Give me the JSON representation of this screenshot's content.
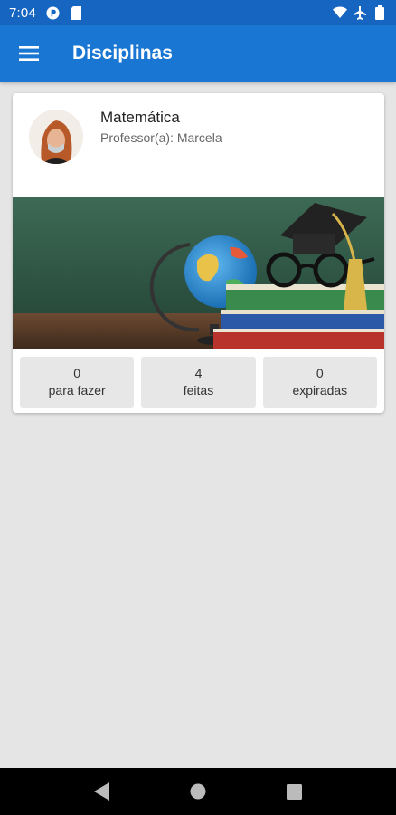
{
  "status_bar": {
    "time": "7:04",
    "icons": [
      "p-circle-icon",
      "sd-card-icon",
      "wifi-icon",
      "airplane-icon",
      "battery-icon"
    ]
  },
  "app_bar": {
    "title": "Disciplinas",
    "menu_icon": "menu-icon",
    "background": "#1976d2"
  },
  "course_card": {
    "subject": "Matemática",
    "teacher_label": "Professor(a):",
    "teacher_name": "Marcela",
    "stats": [
      {
        "count": "0",
        "label": "para fazer"
      },
      {
        "count": "4",
        "label": "feitas"
      },
      {
        "count": "0",
        "label": "expiradas"
      }
    ]
  },
  "nav_bar": {
    "buttons": [
      "back-icon",
      "home-icon",
      "recents-icon"
    ]
  },
  "colors": {
    "primary": "#1976d2",
    "status_bar": "#1665c1",
    "background": "#e5e5e5",
    "stat_tile": "#e7e7e7"
  }
}
